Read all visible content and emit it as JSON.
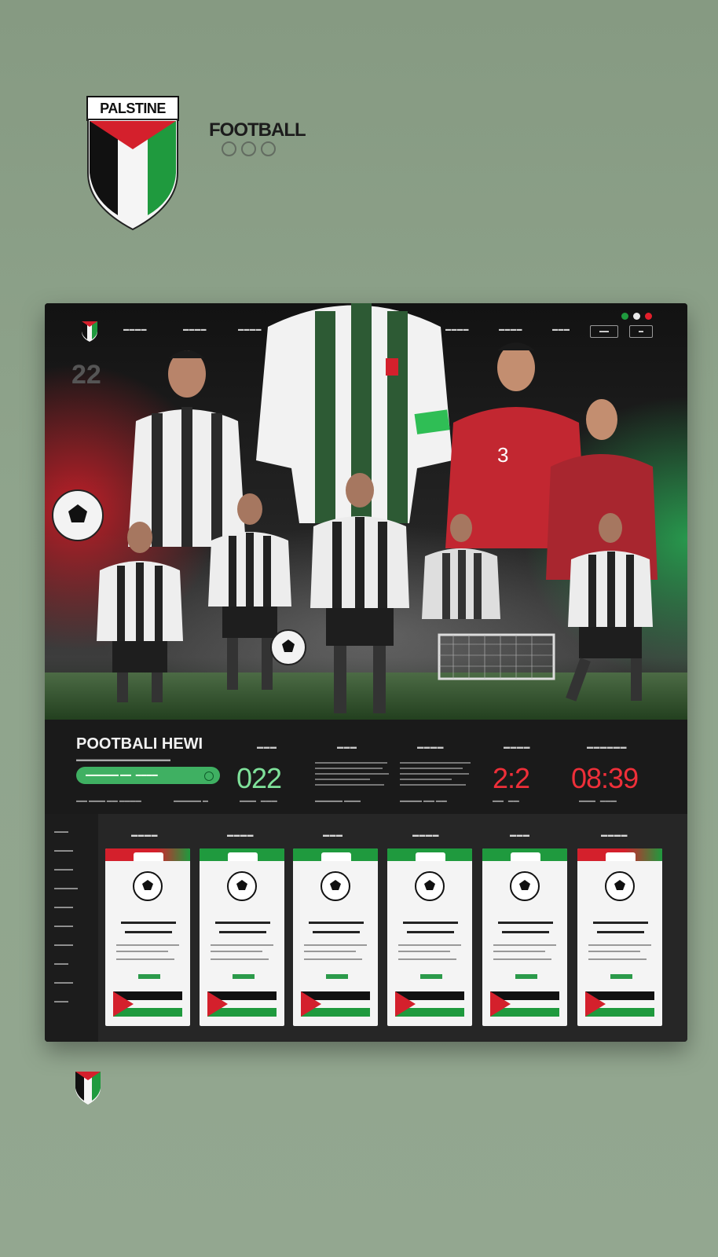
{
  "brand": {
    "crest_label": "PALSTINE",
    "wordmark": "FOOTBALL"
  },
  "colors": {
    "flag_black": "#111111",
    "flag_white": "#f5f5f5",
    "flag_green": "#1f9a3e",
    "flag_red": "#d4202c",
    "accent_green": "#3fb062",
    "score_red": "#ee2f39",
    "score_green": "#7fe19a"
  },
  "hero": {
    "year_mark": "22",
    "jersey_number": "3"
  },
  "strip": {
    "title": "POOTBALI HEWI",
    "score_left": "022",
    "score_mid": "2:2",
    "score_right": "08:39"
  },
  "icons": {
    "crest": "palestine-shield-icon",
    "nav_logo": "palestine-shield-icon",
    "ball": "football-icon",
    "flag": "palestine-flag-icon"
  }
}
